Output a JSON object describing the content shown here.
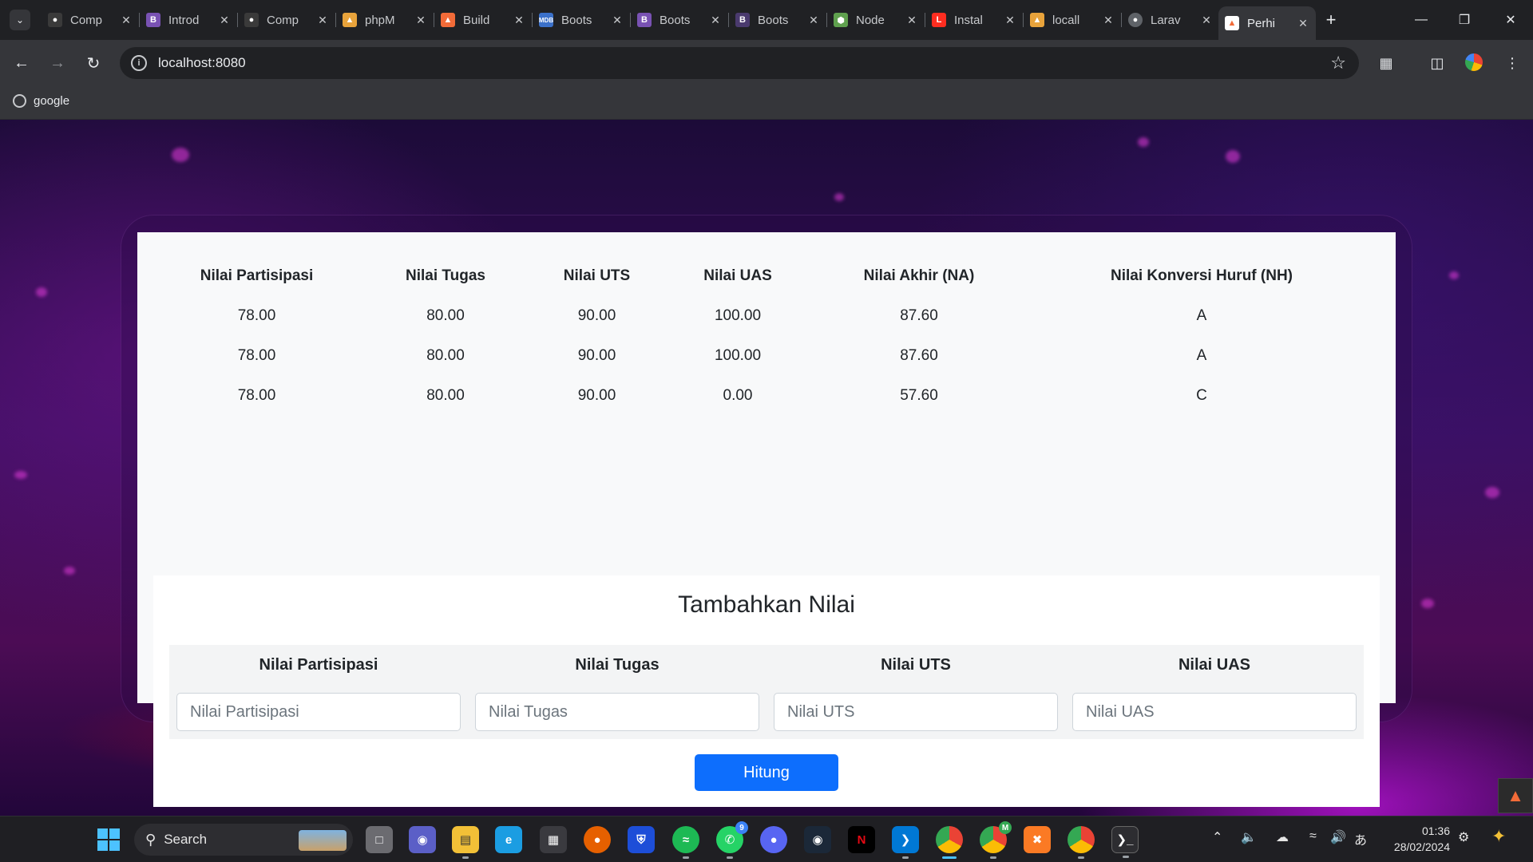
{
  "browser": {
    "tabs": [
      {
        "title": "Comp",
        "favicon": "panda-icon",
        "color": "#3a3a3a"
      },
      {
        "title": "Introd",
        "favicon": "bootstrap-icon",
        "color": "#7952b3"
      },
      {
        "title": "Comp",
        "favicon": "panda-icon",
        "color": "#3a3a3a"
      },
      {
        "title": "phpM",
        "favicon": "phpmyadmin-icon",
        "color": "#e8a33b"
      },
      {
        "title": "Build",
        "favicon": "fire-icon",
        "color": "#f26b38"
      },
      {
        "title": "Boots",
        "favicon": "mdb-icon",
        "color": "#3b71ca"
      },
      {
        "title": "Boots",
        "favicon": "bootstrap-icon",
        "color": "#7952b3"
      },
      {
        "title": "Boots",
        "favicon": "bootstrap-icon",
        "color": "#4a3a6e"
      },
      {
        "title": "Node",
        "favicon": "nodejs-icon",
        "color": "#5fa04e"
      },
      {
        "title": "Instal",
        "favicon": "laravel-icon",
        "color": "#ff2d20"
      },
      {
        "title": "locall",
        "favicon": "phpmyadmin-icon",
        "color": "#e8a33b"
      },
      {
        "title": "Larav",
        "favicon": "globe-icon",
        "color": "#5f6368"
      },
      {
        "title": "Perhi",
        "favicon": "fire-icon",
        "color": "#f26b38"
      }
    ],
    "new_tab": "+",
    "address": "localhost:8080",
    "bookmark_label": "google"
  },
  "grades_table": {
    "headers": [
      "Nilai Partisipasi",
      "Nilai Tugas",
      "Nilai UTS",
      "Nilai UAS",
      "Nilai Akhir (NA)",
      "Nilai Konversi Huruf (NH)"
    ],
    "rows": [
      [
        "78.00",
        "80.00",
        "90.00",
        "100.00",
        "87.60",
        "A"
      ],
      [
        "78.00",
        "80.00",
        "90.00",
        "100.00",
        "87.60",
        "A"
      ],
      [
        "78.00",
        "80.00",
        "90.00",
        "0.00",
        "57.60",
        "C"
      ]
    ]
  },
  "form": {
    "title": "Tambahkan Nilai",
    "fields": [
      {
        "label": "Nilai Partisipasi",
        "placeholder": "Nilai Partisipasi",
        "value": ""
      },
      {
        "label": "Nilai Tugas",
        "placeholder": "Nilai Tugas",
        "value": ""
      },
      {
        "label": "Nilai UTS",
        "placeholder": "Nilai UTS",
        "value": ""
      },
      {
        "label": "Nilai UAS",
        "placeholder": "Nilai UAS",
        "value": ""
      }
    ],
    "submit_label": "Hitung",
    "submit_color": "#0d6efd"
  },
  "taskbar": {
    "search_label": "Search",
    "whatsapp_badge": "9",
    "chrome_profile_badge": "M",
    "time": "01:36",
    "date": "28/02/2024"
  }
}
